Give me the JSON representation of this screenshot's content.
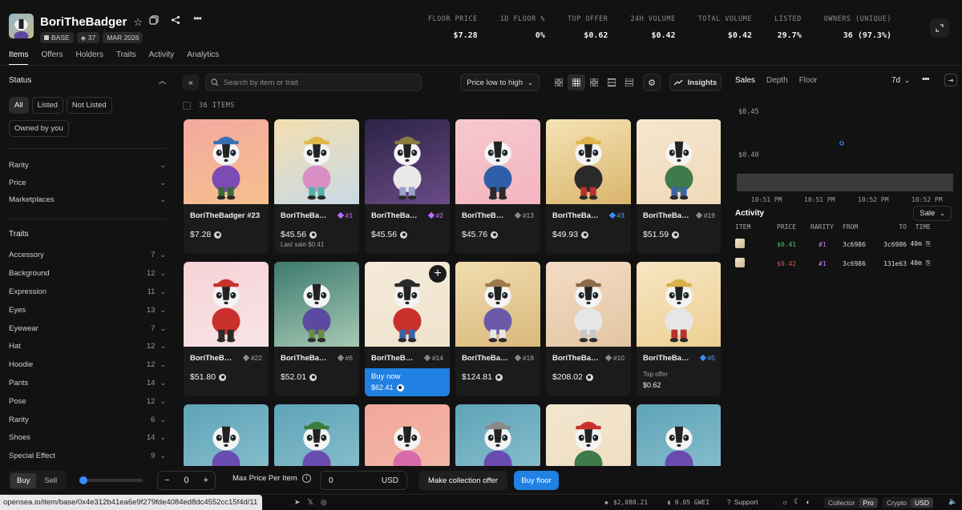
{
  "collection": {
    "name": "BoriTheBadger",
    "chain": "BASE",
    "items_count": "37",
    "date": "MAR 2026"
  },
  "stats": [
    {
      "label": "FLOOR PRICE",
      "value": "$7.28"
    },
    {
      "label": "1D FLOOR %",
      "value": "0%"
    },
    {
      "label": "TOP OFFER",
      "value": "$0.62"
    },
    {
      "label": "24H VOLUME",
      "value": "$0.42"
    },
    {
      "label": "TOTAL VOLUME",
      "value": "$0.42"
    },
    {
      "label": "LISTED",
      "value": "29.7%"
    },
    {
      "label": "OWNERS (UNIQUE)",
      "value": "36 (97.3%)"
    }
  ],
  "tabs": [
    "Items",
    "Offers",
    "Holders",
    "Traits",
    "Activity",
    "Analytics"
  ],
  "sidebar": {
    "status_title": "Status",
    "status_pills": [
      "All",
      "Listed",
      "Not Listed"
    ],
    "owned_pill": "Owned by you",
    "filters": [
      "Rarity",
      "Price",
      "Marketplaces"
    ],
    "traits_title": "Traits",
    "traits": [
      {
        "name": "Accessory",
        "count": "7"
      },
      {
        "name": "Background",
        "count": "12"
      },
      {
        "name": "Expression",
        "count": "11"
      },
      {
        "name": "Eyes",
        "count": "13"
      },
      {
        "name": "Eyewear",
        "count": "7"
      },
      {
        "name": "Hat",
        "count": "12"
      },
      {
        "name": "Hoodie",
        "count": "12"
      },
      {
        "name": "Pants",
        "count": "14"
      },
      {
        "name": "Pose",
        "count": "12"
      },
      {
        "name": "Rarity",
        "count": "6"
      },
      {
        "name": "Shoes",
        "count": "14"
      },
      {
        "name": "Special Effect",
        "count": "9"
      }
    ]
  },
  "toolbar": {
    "search_placeholder": "Search by item or trait",
    "sort": "Price low to high",
    "insights": "Insights",
    "items_count": "36 ITEMS"
  },
  "cards": [
    {
      "name": "BoriTheBadger #23",
      "rank": "",
      "rank_color": "",
      "price": "$7.28",
      "sub": "",
      "bg": [
        "#f2a9a0",
        "#f6c08c"
      ],
      "hat": "#3a6fb4",
      "hoodie": "#7d4bb5",
      "pants": "#3b6b3b"
    },
    {
      "name": "BoriTheBa…",
      "rank": "#1",
      "rank_color": "p",
      "price": "$45.56",
      "sub": "Last sale $0.41",
      "bg": [
        "#f3dfb0",
        "#c9d9e6"
      ],
      "hat": "#e0b64a",
      "hoodie": "#d98fc4",
      "pants": "#4fb2a8"
    },
    {
      "name": "BoriTheBa…",
      "rank": "#2",
      "rank_color": "p",
      "price": "$45.56",
      "sub": "",
      "bg": [
        "#2b2346",
        "#6a4b86"
      ],
      "hat": "#8a7a3c",
      "hoodie": "#e8e8e8",
      "pants": "#9aa2c9"
    },
    {
      "name": "BoriTheB…",
      "rank": "#13",
      "rank_color": "",
      "price": "$45.76",
      "sub": "",
      "bg": [
        "#f6c8cf",
        "#f3b5c0"
      ],
      "hat": "",
      "hoodie": "#2f5fa8",
      "pants": "#2a2a2a"
    },
    {
      "name": "BoriTheBa…",
      "rank": "#3",
      "rank_color": "b",
      "price": "$49.93",
      "sub": "",
      "bg": [
        "#f5e3b5",
        "#d9b56c"
      ],
      "hat": "#e0b64a",
      "hoodie": "#2a2a2a",
      "pants": "#b5322d"
    },
    {
      "name": "BoriTheBa…",
      "rank": "#19",
      "rank_color": "",
      "price": "$51.59",
      "sub": "",
      "bg": [
        "#f5e6cf",
        "#f0d9b8"
      ],
      "hat": "",
      "hoodie": "#3e7a4a",
      "pants": "#3b63a8"
    },
    {
      "name": "BoriTheB…",
      "rank": "#22",
      "rank_color": "",
      "price": "$51.80",
      "sub": "",
      "bg": [
        "#f6d2d6",
        "#f8e4e6"
      ],
      "hat": "#c9302c",
      "hoodie": "#c9302c",
      "pants": "#2a2a2a"
    },
    {
      "name": "BoriTheBa…",
      "rank": "#6",
      "rank_color": "",
      "price": "$52.01",
      "sub": "",
      "bg": [
        "#3d7a6f",
        "#a6c9b4"
      ],
      "hat": "",
      "hoodie": "#5b4aa0",
      "pants": "#6c8a4a"
    },
    {
      "name": "BoriTheB…",
      "rank": "#14",
      "rank_color": "",
      "price": "",
      "sub": "",
      "bg": [
        "#f4ead7",
        "#efe3cf"
      ],
      "hat": "#2a2a2a",
      "hoodie": "#c9302c",
      "pants": "#3b63a8",
      "buy_now": "Buy now",
      "buy_price": "$62.41"
    },
    {
      "name": "BoriTheBa…",
      "rank": "#18",
      "rank_color": "",
      "price": "$124.81",
      "sub": "",
      "bg": [
        "#f1ddb0",
        "#d9b87a"
      ],
      "hat": "#9c7a4e",
      "hoodie": "#6a5aa8",
      "pants": "#e6e6e6"
    },
    {
      "name": "BoriTheBa…",
      "rank": "#10",
      "rank_color": "",
      "price": "$208.02",
      "sub": "",
      "bg": [
        "#f3dcc4",
        "#e3c5a4"
      ],
      "hat": "#8b6b47",
      "hoodie": "#e6e6e6",
      "pants": "#c9c9c9"
    },
    {
      "name": "BoriTheBa…",
      "rank": "#5",
      "rank_color": "b",
      "price": "",
      "sub": "",
      "bg": [
        "#f6e6c3",
        "#edcf93"
      ],
      "hat": "#d8b04a",
      "hoodie": "#e6e6e6",
      "pants": "#b5322d",
      "top_offer_label": "Top offer",
      "top_offer": "$0.62"
    },
    {
      "name": "",
      "rank": "",
      "rank_color": "",
      "price": "",
      "sub": "",
      "bg": [
        "#5fa4b8",
        "#8cc2cf"
      ],
      "hat": "",
      "hoodie": "#6a4bb0",
      "pants": "#3b3b3b"
    },
    {
      "name": "",
      "rank": "",
      "rank_color": "",
      "price": "",
      "sub": "",
      "bg": [
        "#5fa4b8",
        "#8cc2cf"
      ],
      "hat": "#3f7a3f",
      "hoodie": "#6a4bb0",
      "pants": "#3b3b3b"
    },
    {
      "name": "",
      "rank": "",
      "rank_color": "",
      "price": "",
      "sub": "",
      "bg": [
        "#f1a79c",
        "#f3b9a9"
      ],
      "hat": "",
      "hoodie": "#d96aa9",
      "pants": "#3b3b3b"
    },
    {
      "name": "",
      "rank": "",
      "rank_color": "",
      "price": "",
      "sub": "",
      "bg": [
        "#5fa4b8",
        "#8cc2cf"
      ],
      "hat": "#8a8a8a",
      "hoodie": "#6a4bb0",
      "pants": "#3b3b3b"
    },
    {
      "name": "",
      "rank": "",
      "rank_color": "",
      "price": "",
      "sub": "",
      "bg": [
        "#f3e6cf",
        "#eedcc0"
      ],
      "hat": "#c9302c",
      "hoodie": "#3e7a4a",
      "pants": "#3b3b3b"
    },
    {
      "name": "",
      "rank": "",
      "rank_color": "",
      "price": "",
      "sub": "",
      "bg": [
        "#5fa4b8",
        "#8cc2cf"
      ],
      "hat": "",
      "hoodie": "#6a4bb0",
      "pants": "#3b3b3b"
    }
  ],
  "right_panel": {
    "tabs": [
      "Sales",
      "Depth",
      "Floor"
    ],
    "range": "7d",
    "chart_ylabels": [
      "$0.45",
      "$0.40"
    ],
    "chart_xlabels": [
      "10:51 PM",
      "10:51 PM",
      "10:52 PM",
      "10:52 PM"
    ],
    "activity_title": "Activity",
    "activity_filter": "Sale",
    "activity_headers": [
      "ITEM",
      "PRICE",
      "RARITY",
      "FROM",
      "TO",
      "TIME"
    ],
    "activity_rows": [
      {
        "price": "$0.41",
        "price_color": "#4cc46b",
        "rarity": "#1",
        "from": "3c6986",
        "to": "3c6986",
        "time": "40m"
      },
      {
        "price": "$0.42",
        "price_color": "#e0514d",
        "rarity": "#1",
        "from": "3c6986",
        "to": "131e63",
        "time": "40m"
      }
    ]
  },
  "bottom": {
    "buy": "Buy",
    "sell": "Sell",
    "qty": "0",
    "max_price_label": "Max Price Per Item",
    "max_price_value": "0",
    "currency": "USD",
    "make_offer": "Make collection offer",
    "buy_floor": "Buy floor"
  },
  "status": {
    "url": "opensea.io/item/base/0x4e312b41ea6e9f279fde4084ed8dc4552cc15f4d/11",
    "eth_price": "$2,080.21",
    "gas": "0.05 GWEI",
    "support": "Support",
    "collector": "Collector",
    "pro": "Pro",
    "crypto": "Crypto",
    "usd": "USD"
  }
}
